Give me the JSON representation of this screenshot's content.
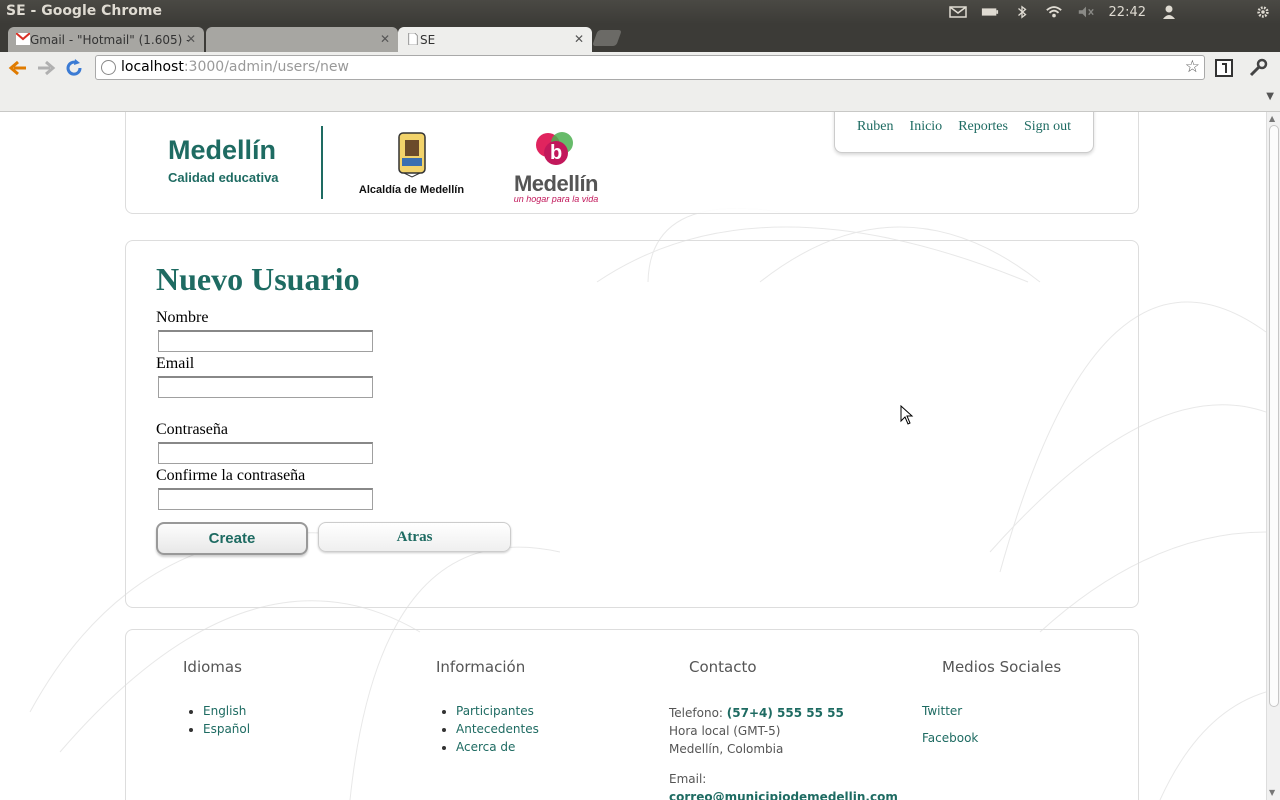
{
  "os": {
    "window_title": "SE - Google Chrome",
    "clock": "22:42"
  },
  "browser": {
    "tabs": [
      {
        "label": "Gmail - \"Hotmail\" (1.605) -",
        "active": false
      },
      {
        "label": "",
        "active": false
      },
      {
        "label": "SE",
        "active": true
      }
    ],
    "url_host": "localhost",
    "url_path": ":3000/admin/users/new"
  },
  "header": {
    "logo_title": "Medellín",
    "logo_subtitle": "Calidad educativa",
    "alcaldia_label": "Alcaldía de Medellín",
    "city_logo_word": "Medellín",
    "city_logo_tagline": "un hogar para la vida",
    "nav": [
      "Ruben",
      "Inicio",
      "Reportes",
      "Sign out"
    ]
  },
  "form": {
    "title": "Nuevo Usuario",
    "fields": [
      {
        "label": "Nombre",
        "value": ""
      },
      {
        "label": "Email",
        "value": ""
      },
      {
        "label": "Contraseña",
        "value": ""
      },
      {
        "label": "Confirme la contraseña",
        "value": ""
      }
    ],
    "create_label": "Create",
    "back_label": "Atras"
  },
  "footer": {
    "idiomas": {
      "title": "Idiomas",
      "items": [
        "English",
        "Español"
      ]
    },
    "informacion": {
      "title": "Información",
      "items": [
        "Participantes",
        "Antecedentes",
        "Acerca de"
      ]
    },
    "contacto": {
      "title": "Contacto",
      "phone_label": "Telefono:",
      "phone": "(57+4) 555 55 55",
      "timezone": "Hora local (GMT-5)",
      "location": "Medellín, Colombia",
      "email_label": "Email:",
      "email": "correo@municipiodemedellin.com"
    },
    "medios": {
      "title": "Medios Sociales",
      "items": [
        "Twitter",
        "Facebook"
      ]
    }
  },
  "colors": {
    "brand": "#1e6b62",
    "accent_pink": "#c2185b"
  }
}
